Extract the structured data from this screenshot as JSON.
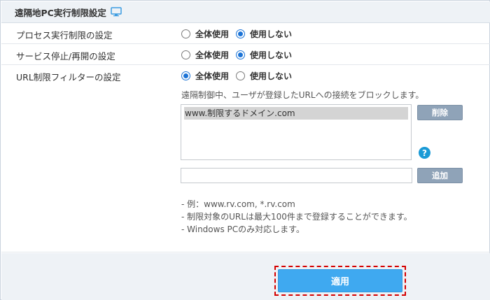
{
  "header": {
    "title": "遠隔地PC実行制限設定",
    "icon": "monitor-icon"
  },
  "settings": [
    {
      "label": "プロセス実行制限の設定",
      "options": [
        "全体使用",
        "使用しない"
      ],
      "selected": 1
    },
    {
      "label": "サービス停止/再開の設定",
      "options": [
        "全体使用",
        "使用しない"
      ],
      "selected": 1
    },
    {
      "label": "URL制限フィルターの設定",
      "options": [
        "全体使用",
        "使用しない"
      ],
      "selected": 0
    }
  ],
  "url_filter": {
    "description": "遠隔制御中、ユーザが登録したURLへの接続をブロックします。",
    "list": [
      "www.制限するドメイン.com"
    ],
    "delete_label": "削除",
    "add_label": "追加",
    "input_value": "",
    "help_symbol": "?",
    "notes": [
      "- 例：www.rv.com, *.rv.com",
      "- 制限対象のURLは最大100件まで登録することができます。",
      "- Windows PCのみ対応します。"
    ]
  },
  "footer": {
    "apply_label": "適用"
  },
  "colors": {
    "accent_blue": "#1b73d6",
    "apply_button": "#3fa9f0",
    "gray_button": "#8fa3b8",
    "help_icon": "#1a9ad6",
    "highlight_border": "#d40000"
  }
}
